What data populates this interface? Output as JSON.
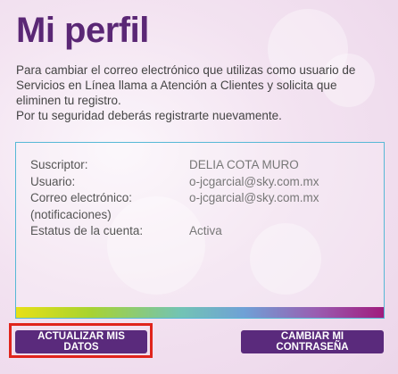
{
  "page": {
    "title": "Mi perfil",
    "intro_text": "Para cambiar el correo electrónico que utilizas como usuario de Servicios en Línea llama a Atención a Clientes y solicita que eliminen tu registro.",
    "intro_note": "Por tu seguridad deberás registrarte nuevamente."
  },
  "profile": {
    "rows": [
      {
        "label": "Suscriptor:",
        "value": "DELIA COTA MURO"
      },
      {
        "label": "Usuario:",
        "value": "o-jcgarcial@sky.com.mx"
      },
      {
        "label": "Correo electrónico:",
        "value": "o-jcgarcial@sky.com.mx"
      },
      {
        "label": "(notificaciones)",
        "value": ""
      },
      {
        "label": "Estatus de la cuenta:",
        "value": "Activa"
      }
    ]
  },
  "actions": {
    "update_label": "ACTUALIZAR MIS DATOS",
    "change_password_label": "CAMBIAR MI CONTRASEÑA"
  },
  "colors": {
    "brand_purple": "#5a2775",
    "card_border": "#56b8d6",
    "highlight_red": "#e0241c"
  }
}
